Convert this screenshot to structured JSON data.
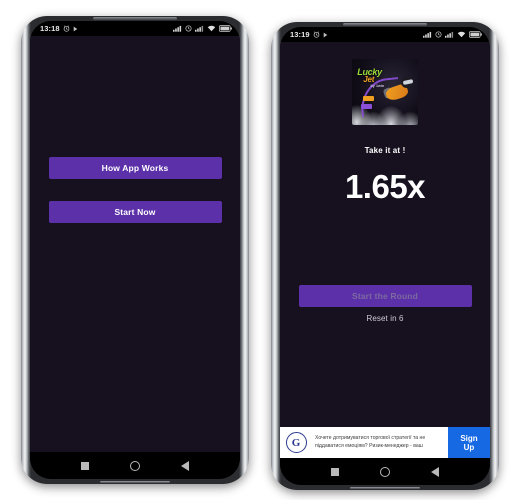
{
  "phones": [
    {
      "id": "left",
      "statusbar": {
        "time": "13:18",
        "icons": [
          "alarm-icon",
          "play-icon",
          "signal-icon",
          "clock-icon",
          "signal2-icon",
          "wifi-icon",
          "battery-icon"
        ]
      },
      "screen": {
        "background": "#16101f",
        "buttons": [
          {
            "label": "How App Works",
            "name": "how-app-works-button",
            "state": "enabled"
          },
          {
            "label": "Start Now",
            "name": "start-now-button",
            "state": "enabled"
          }
        ]
      },
      "navbar": {
        "recents": "recents-button",
        "home": "home-button",
        "back": "back-button"
      }
    },
    {
      "id": "right",
      "statusbar": {
        "time": "13:19",
        "icons": [
          "alarm-icon",
          "play-icon",
          "signal-icon",
          "clock-icon",
          "signal2-icon",
          "wifi-icon",
          "battery-icon"
        ]
      },
      "screen": {
        "background": "#16101f",
        "logo": {
          "title": "Lucky",
          "subtitle": "Jet",
          "tagline": "by 1win",
          "alt": "lucky-jet-game-logo"
        },
        "take_label": "Take it at !",
        "multiplier": "1.65x",
        "round_button": {
          "label": "Start the Round",
          "state": "disabled"
        },
        "reset_label": "Reset in 6"
      },
      "ad": {
        "brand_mark": "G",
        "text": "Хочете дотримуватися торгової стратегії та не піддаватися емоціям? Ризик-менеджер - ваш",
        "cta": "Sign Up"
      },
      "navbar": {
        "recents": "recents-button",
        "home": "home-button",
        "back": "back-button"
      }
    }
  ],
  "colors": {
    "accent_purple": "#5b30a8",
    "screen_bg": "#16101f",
    "ad_blue": "#1668e3",
    "text_white": "#ffffff",
    "disabled_text": "#7d6aa0"
  }
}
